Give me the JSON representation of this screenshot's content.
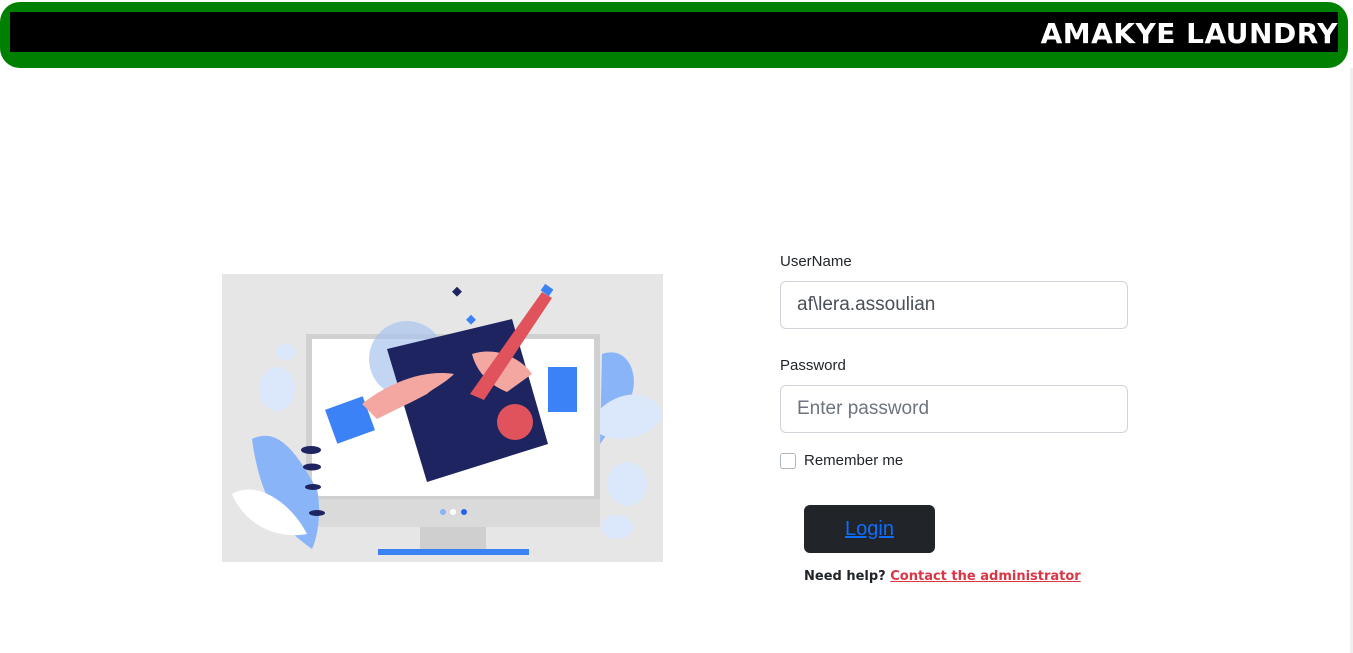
{
  "header": {
    "brand": "AMAKYE LAUNDRY"
  },
  "form": {
    "username_label": "UserName",
    "username_value": "af\\lera.assoulian",
    "password_label": "Password",
    "password_placeholder": "Enter password",
    "remember_label": "Remember me",
    "login_label": "Login",
    "help_text": "Need help?",
    "help_link": "Contact the administrator"
  },
  "colors": {
    "header_green": "#008000",
    "header_black": "#000000",
    "button_dark": "#212529",
    "link_blue": "#0d6efd",
    "help_red": "#dc3545"
  }
}
